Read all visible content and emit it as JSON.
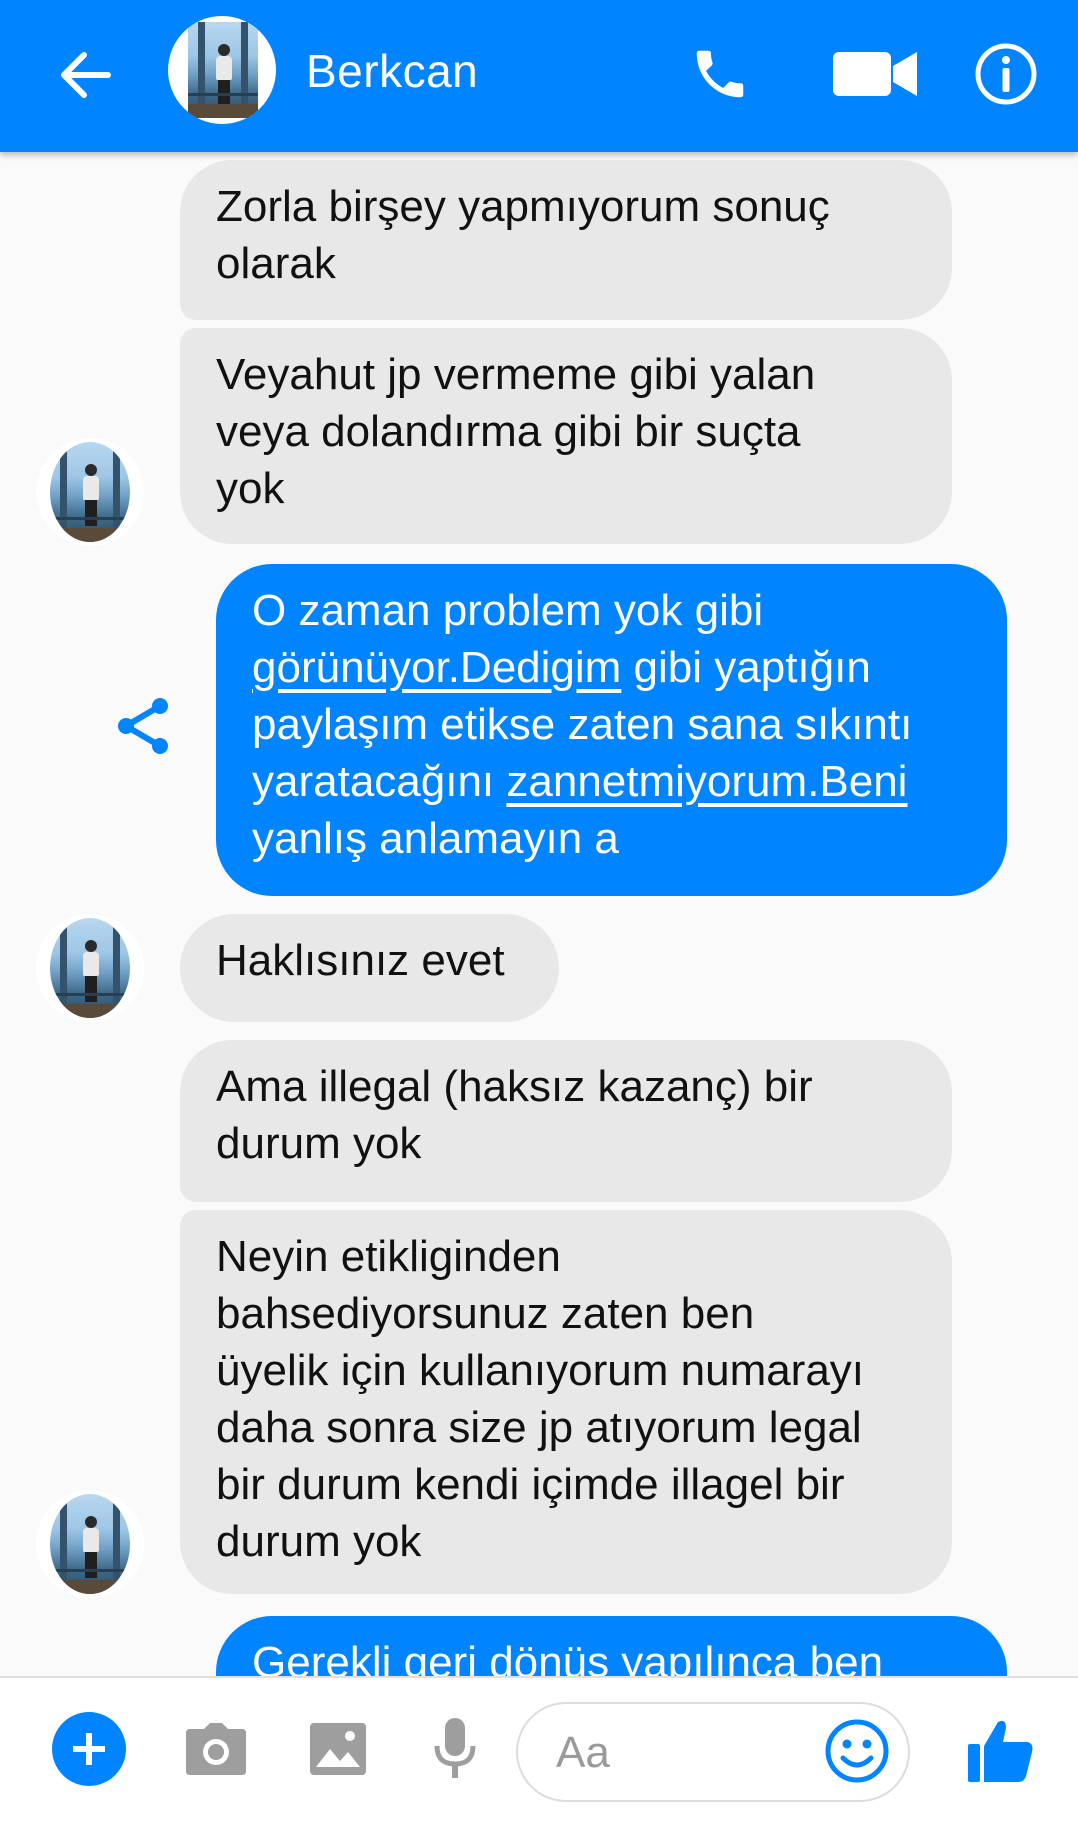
{
  "header": {
    "contact_name": "Berkcan",
    "icons": [
      "arrow-back-icon",
      "phone-icon",
      "video-camera-icon",
      "info-icon"
    ]
  },
  "messages": [
    {
      "direction": "incoming",
      "text": "Zorla birşey yapmıyorum sonuç\nolarak"
    },
    {
      "direction": "incoming",
      "text": "Veyahut jp vermeme gibi yalan\nveya dolandırma gibi bir suçta\nyok"
    },
    {
      "direction": "outgoing",
      "parts": {
        "p1": "O zaman problem yok gibi\n",
        "link1": "görünüyor.Dedigim",
        "p2": " gibi yaptığın\npaylaşım etikse zaten sana sıkıntı\nyaratacağını ",
        "link2": "zannetmiyorum.Beni",
        "p3": "\nyanlış anlamayın a"
      }
    },
    {
      "direction": "incoming",
      "text": "Haklısınız evet"
    },
    {
      "direction": "incoming",
      "text": "Ama illegal (haksız kazanç) bir\ndurum yok"
    },
    {
      "direction": "incoming",
      "text": "Neyin etikliginden\nbahsediyorsunuz zaten ben\nüyelik için kullanıyorum numarayı\ndaha sonra size jp atıyorum legal\nbir durum kendi içimde illagel bir\ndurum yok"
    },
    {
      "direction": "outgoing",
      "text": "Gerekli geri dönüş yapılınca ben"
    }
  ],
  "composer": {
    "placeholder": "Aa",
    "icons": [
      "plus-icon",
      "camera-icon",
      "gallery-icon",
      "microphone-icon",
      "emoji-icon",
      "thumbs-up-icon"
    ]
  },
  "colors": {
    "accent": "#0084ff",
    "incoming_bubble": "#e8e8e8",
    "background": "#fafafa"
  }
}
